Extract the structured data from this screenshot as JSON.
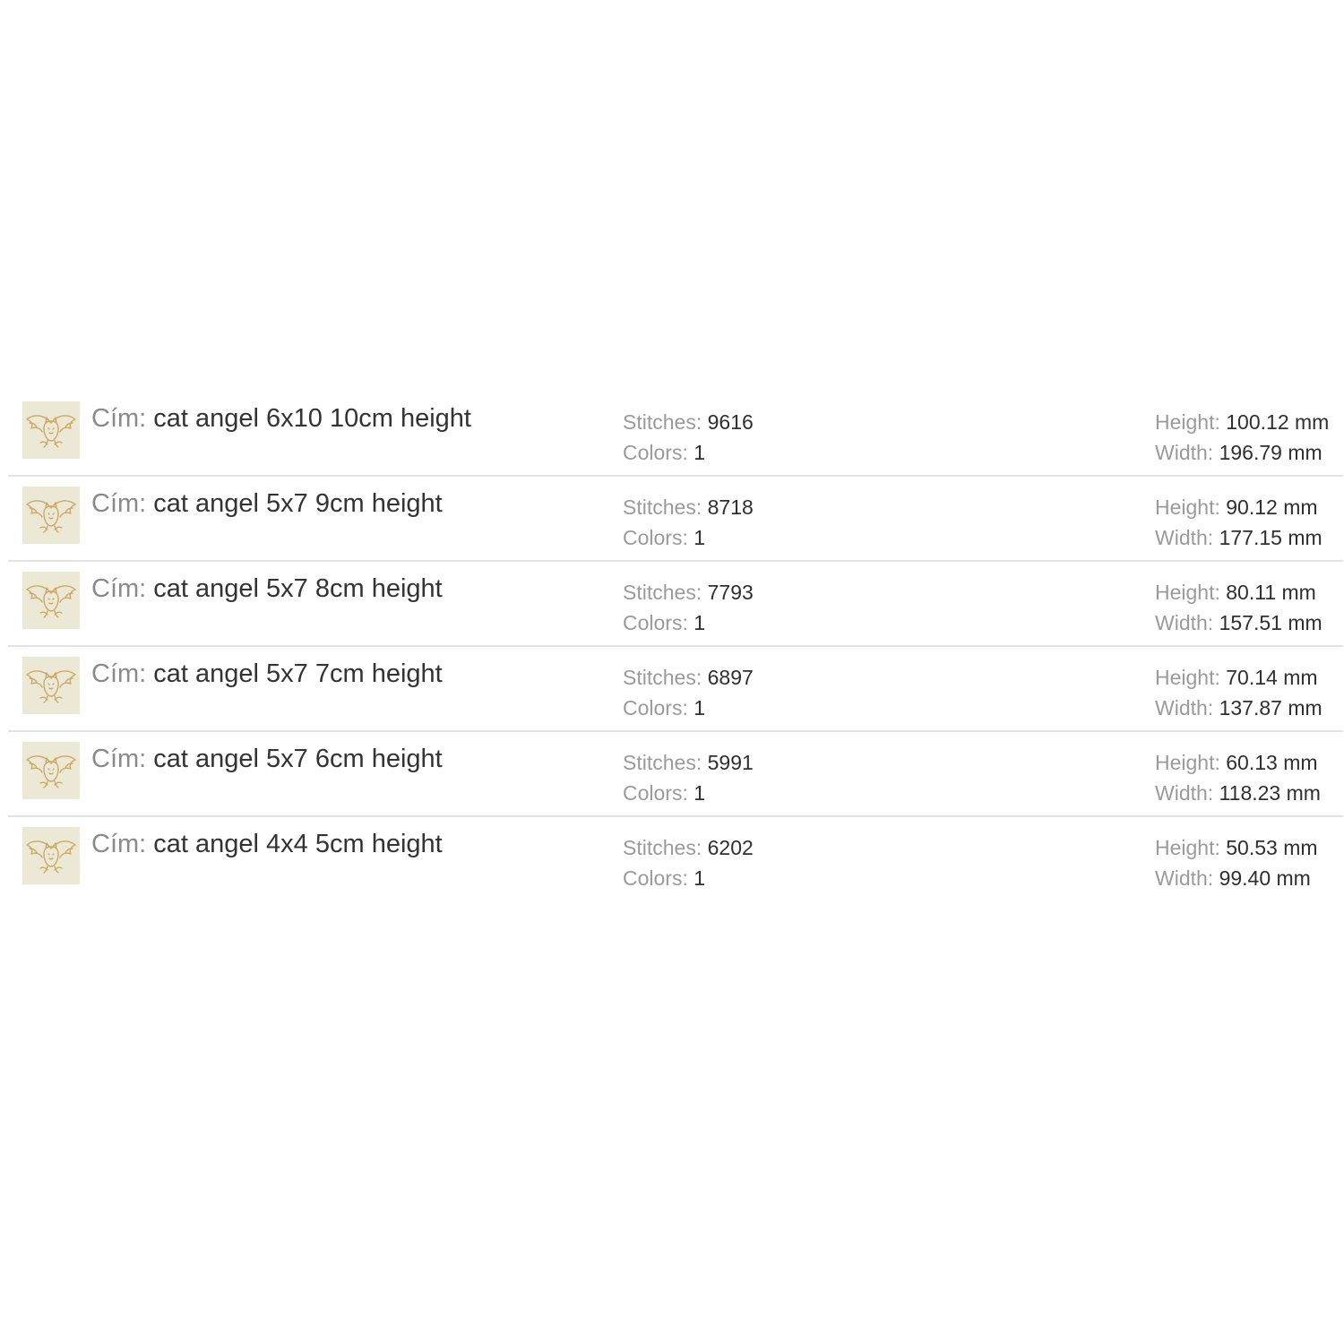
{
  "labels": {
    "title": "Cím:",
    "stitches": "Stitches:",
    "colors": "Colors:",
    "height": "Height:",
    "width": "Width:"
  },
  "thumbnail_icon": "cat-angel-embroidery-thumbnail",
  "colors_theme": {
    "thumb_background": "#ece8d6",
    "thumb_stroke": "#c9a35a",
    "divider": "#e3e3e3"
  },
  "designs": [
    {
      "title": "cat angel 6x10 10cm height",
      "stitches": "9616",
      "colors": "1",
      "height": "100.12 mm",
      "width": "196.79 mm"
    },
    {
      "title": "cat angel 5x7 9cm height",
      "stitches": "8718",
      "colors": "1",
      "height": "90.12 mm",
      "width": "177.15 mm"
    },
    {
      "title": "cat angel 5x7 8cm height",
      "stitches": "7793",
      "colors": "1",
      "height": "80.11 mm",
      "width": "157.51 mm"
    },
    {
      "title": "cat angel 5x7 7cm height",
      "stitches": "6897",
      "colors": "1",
      "height": "70.14 mm",
      "width": "137.87 mm"
    },
    {
      "title": "cat angel 5x7 6cm height",
      "stitches": "5991",
      "colors": "1",
      "height": "60.13 mm",
      "width": "118.23 mm"
    },
    {
      "title": "cat angel 4x4 5cm height",
      "stitches": "6202",
      "colors": "1",
      "height": "50.53 mm",
      "width": "99.40 mm"
    }
  ]
}
